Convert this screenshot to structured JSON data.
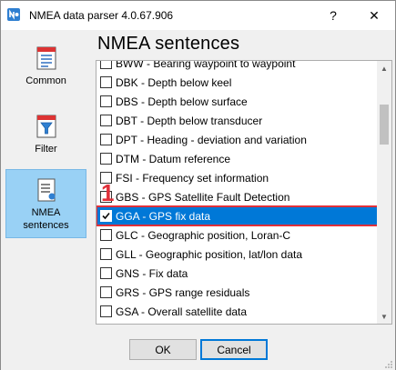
{
  "window": {
    "title": "NMEA data parser 4.0.67.906",
    "help_label": "?",
    "close_label": "✕"
  },
  "sidebar": {
    "items": [
      {
        "label": "Common",
        "icon": "document-icon",
        "active": false
      },
      {
        "label": "Filter",
        "icon": "filter-icon",
        "active": false
      },
      {
        "label": "NMEA\nsentences",
        "icon": "nmea-sentences-icon",
        "active": true
      }
    ]
  },
  "main": {
    "heading": "NMEA sentences",
    "badge": "1",
    "list": [
      {
        "label": "BWW - Bearing waypoint to waypoint",
        "checked": false,
        "selected": false
      },
      {
        "label": "DBK - Depth below keel",
        "checked": false,
        "selected": false
      },
      {
        "label": "DBS - Depth below surface",
        "checked": false,
        "selected": false
      },
      {
        "label": "DBT - Depth below transducer",
        "checked": false,
        "selected": false
      },
      {
        "label": "DPT - Heading - deviation and variation",
        "checked": false,
        "selected": false
      },
      {
        "label": "DTM - Datum reference",
        "checked": false,
        "selected": false
      },
      {
        "label": "FSI - Frequency set information",
        "checked": false,
        "selected": false
      },
      {
        "label": "GBS - GPS Satellite Fault Detection",
        "checked": false,
        "selected": false
      },
      {
        "label": "GGA - GPS fix data",
        "checked": true,
        "selected": true
      },
      {
        "label": "GLC - Geographic position, Loran-C",
        "checked": false,
        "selected": false
      },
      {
        "label": "GLL - Geographic position, lat/lon data",
        "checked": false,
        "selected": false
      },
      {
        "label": "GNS - Fix data",
        "checked": false,
        "selected": false
      },
      {
        "label": "GRS - GPS range residuals",
        "checked": false,
        "selected": false
      },
      {
        "label": "GSA - Overall satellite data",
        "checked": false,
        "selected": false
      }
    ]
  },
  "footer": {
    "ok_label": "OK",
    "cancel_label": "Cancel"
  },
  "colors": {
    "selection": "#0078d7",
    "highlight_box": "#e0303a",
    "sidebar_active": "#99d1f5"
  }
}
